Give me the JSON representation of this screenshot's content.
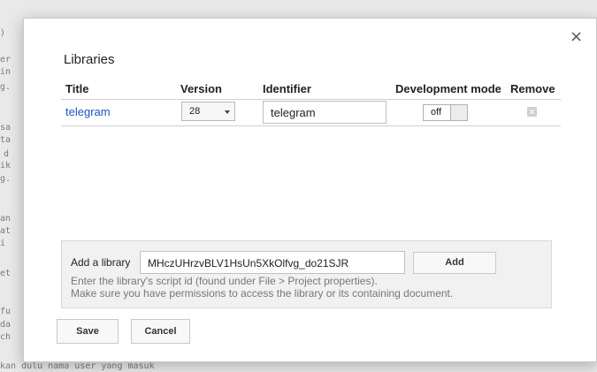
{
  "background": {
    "lines": [
      ")",
      "er",
      "in",
      "g.",
      "sa",
      "ta",
      "d",
      "ik",
      "g.",
      "an",
      "at",
      "i",
      "et",
      "fu",
      "da",
      "ch"
    ],
    "bottom_text": "kan dulu nama user yang masuk"
  },
  "dialog": {
    "title": "Libraries",
    "close_icon": "×"
  },
  "table": {
    "headers": {
      "title": "Title",
      "version": "Version",
      "identifier": "Identifier",
      "development_mode": "Development mode",
      "remove": "Remove"
    },
    "rows": [
      {
        "title": "telegram",
        "version": "28",
        "identifier": "telegram",
        "development_mode": "off"
      }
    ]
  },
  "add_library": {
    "label": "Add a library",
    "input_value": "MHczUHrzvBLV1HsUn5XkOlfvg_do21SJR",
    "button": "Add",
    "hint_line1": "Enter the library's script id (found under File > Project properties).",
    "hint_line2": "Make sure you have permissions to access the library or its containing document."
  },
  "buttons": {
    "save": "Save",
    "cancel": "Cancel"
  },
  "colors": {
    "link": "#1a55c5",
    "overlay_bg": "#e9e9e9"
  }
}
